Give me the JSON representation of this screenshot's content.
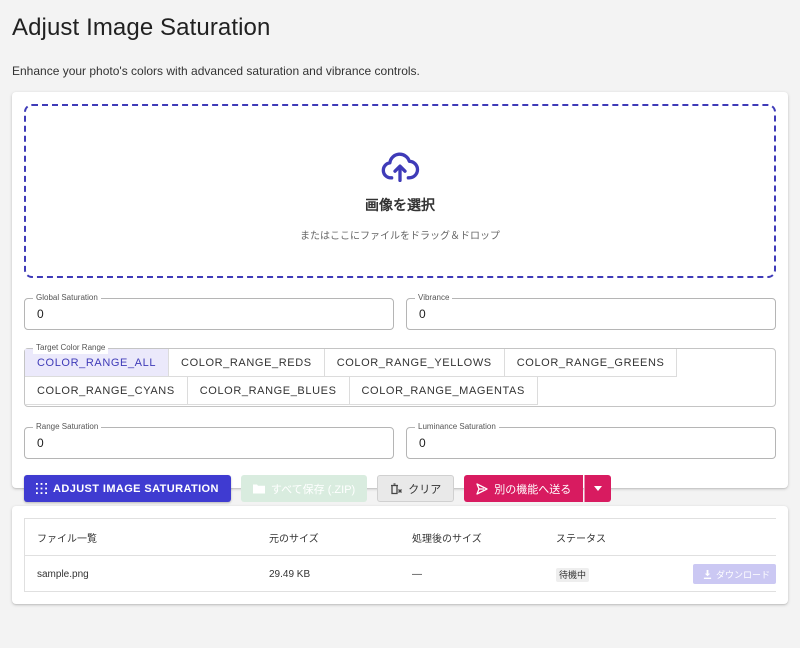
{
  "header": {
    "title": "Adjust Image Saturation",
    "subtitle": "Enhance your photo's colors with advanced saturation and vibrance controls."
  },
  "dropzone": {
    "title": "画像を選択",
    "hint": "またはここにファイルをドラッグ＆ドロップ",
    "icon": "cloud-upload-icon"
  },
  "fields": {
    "global_saturation": {
      "label": "Global Saturation",
      "value": "0"
    },
    "vibrance": {
      "label": "Vibrance",
      "value": "0"
    },
    "range_saturation": {
      "label": "Range Saturation",
      "value": "0"
    },
    "luminance_saturation": {
      "label": "Luminance Saturation",
      "value": "0"
    }
  },
  "color_range": {
    "label": "Target Color Range",
    "selected": "COLOR_RANGE_ALL",
    "options": [
      "COLOR_RANGE_ALL",
      "COLOR_RANGE_REDS",
      "COLOR_RANGE_YELLOWS",
      "COLOR_RANGE_GREENS",
      "COLOR_RANGE_CYANS",
      "COLOR_RANGE_BLUES",
      "COLOR_RANGE_MAGENTAS"
    ]
  },
  "actions": {
    "adjust_label": "ADJUST IMAGE SATURATION",
    "save_all_label": "すべて保存 (.ZIP)",
    "clear_label": "クリア",
    "send_label": "別の機能へ送る"
  },
  "files": {
    "headers": [
      "ファイル一覧",
      "元のサイズ",
      "処理後のサイズ",
      "ステータス"
    ],
    "rows": [
      {
        "name": "sample.png",
        "original_size": "29.49 KB",
        "processed_size": "—",
        "status": "待機中",
        "download_label": "ダウンロード"
      }
    ]
  },
  "colors": {
    "primary": "#3f3bd1",
    "accent": "#d81b60",
    "background": "#f3f3f3"
  }
}
